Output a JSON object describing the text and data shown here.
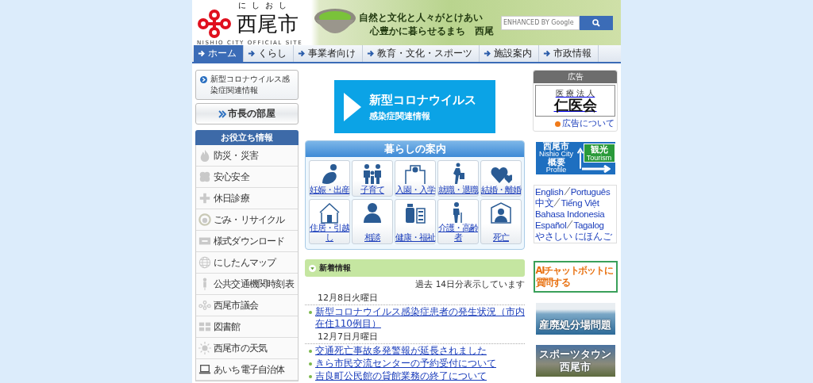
{
  "header": {
    "logo_kana": "にしおし",
    "logo_text": "西尾市",
    "logo_subtitle": "NISHIO CITY OFFICIAL SITE",
    "slogan_lines": [
      "自然と文化と人々がとけあい",
      "心豊かに暮らせるまち　西尾"
    ],
    "search": {
      "placeholder": "ENHANCED BY Google"
    }
  },
  "nav": [
    {
      "label": "ホーム",
      "selected": true
    },
    {
      "label": "くらし",
      "selected": false
    },
    {
      "label": "事業者向け",
      "selected": false
    },
    {
      "label": "教育・文化・スポーツ",
      "selected": false
    },
    {
      "label": "施設案内",
      "selected": false
    },
    {
      "label": "市政情報",
      "selected": false
    }
  ],
  "left": {
    "corona_link": "新型コロナウイルス感染症関連情報",
    "mayor_button": "市長の部屋",
    "useful_title": "お役立ち情報",
    "useful_items": [
      "防災・災害",
      "安心安全",
      "休日診療",
      "ごみ・リサイクル",
      "様式ダウンロード",
      "にしたんマップ",
      "公共交通機関時刻表",
      "西尾市議会",
      "図書館",
      "西尾市の天気",
      "あいち電子自治体"
    ]
  },
  "center": {
    "banner": {
      "title": "新型コロナウイルス",
      "subtitle": "感染症関連情報"
    },
    "living_guide": {
      "title": "暮らしの案内",
      "items": [
        "妊娠・出産",
        "子育て",
        "入園・入学",
        "就職・退職",
        "結婚・離婚",
        "住居・引越し",
        "相談",
        "健康・福祉",
        "介護・高齢者",
        "死亡"
      ]
    },
    "news": {
      "title": "新着情報",
      "note": "過去 14日分表示しています",
      "days": [
        {
          "date": "12月8日火曜日",
          "items": [
            "新型コロナウイルス感染症患者の発生状況（市内在住110例目）"
          ]
        },
        {
          "date": "12月7日月曜日",
          "items": [
            "交通死亡事故多発警報が延長されました",
            "きら市民交流センターの予約受付について",
            "吉良町公民館の貸館業務の終了について"
          ]
        }
      ]
    }
  },
  "right": {
    "ad": {
      "title": "広告",
      "sponsor_type": "医 療 法 人",
      "sponsor": "仁医会",
      "link": "広告について"
    },
    "profile_banner": {
      "city": "西尾市",
      "city_en": "Nishio City",
      "profile": "概要",
      "profile_en": "Profile",
      "tourism": "観光",
      "tourism_en": "Tourism"
    },
    "languages": [
      [
        "English",
        "Português"
      ],
      [
        "中文",
        "Tiếng Việt"
      ],
      [
        "Bahasa Indonesia"
      ],
      [
        "Español",
        "Tagalog"
      ],
      [
        "やさしい にほんご"
      ]
    ],
    "chatbot_banner": [
      "AIチャットボットに",
      "質問する"
    ],
    "photo_banners": [
      [
        "産廃処分場問題"
      ],
      [
        "スポーツタウン",
        "西尾市"
      ]
    ]
  }
}
